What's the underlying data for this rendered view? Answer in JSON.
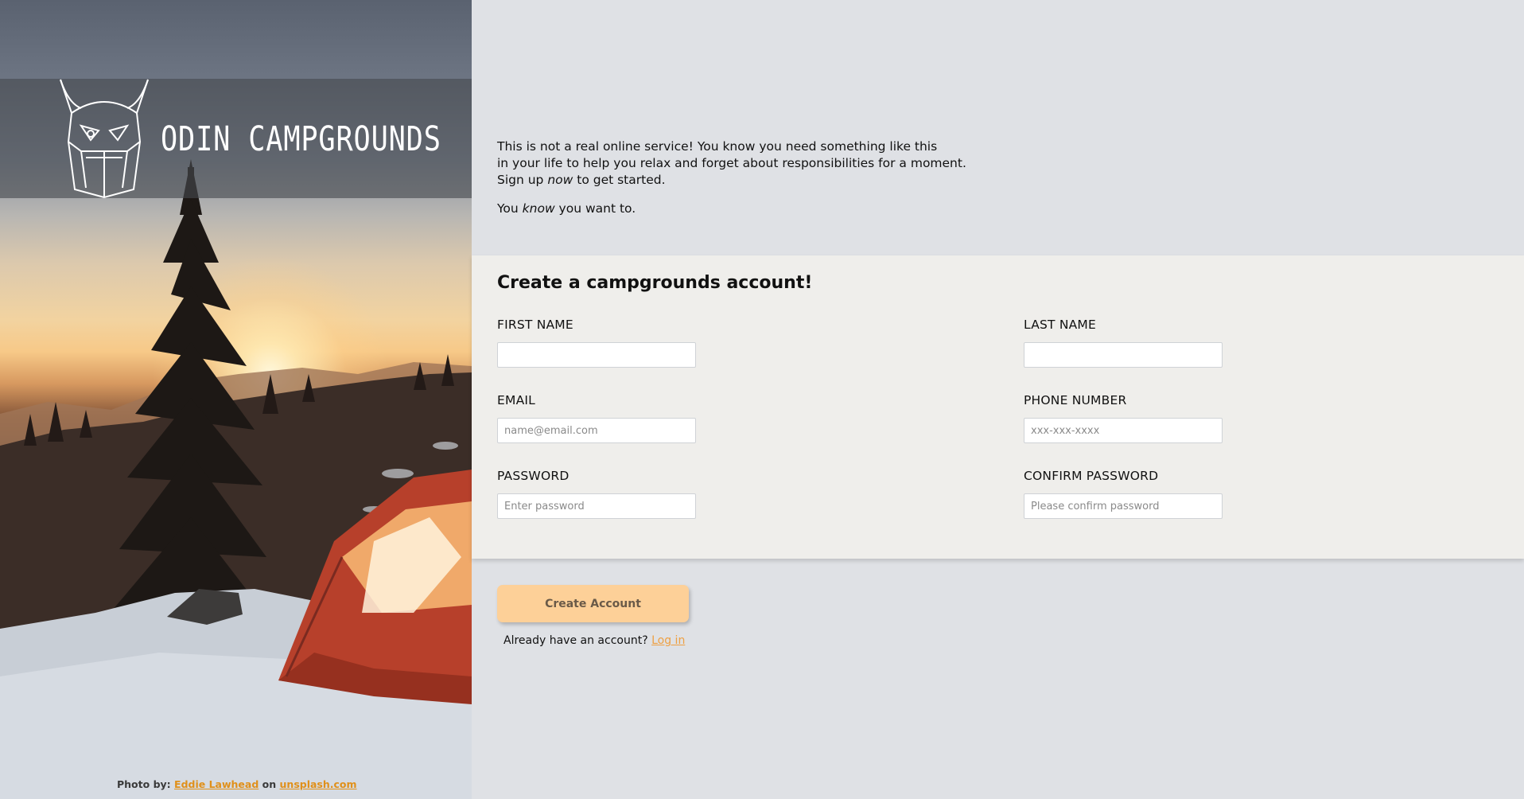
{
  "brand": {
    "title": "ODIN CAMPGROUNDS",
    "logo_icon": "viking-helmet-icon"
  },
  "credit": {
    "prefix": "Photo by:",
    "author": "Eddie Lawhead",
    "middle": "on",
    "site": "unsplash.com"
  },
  "intro": {
    "line1": "This is not a real online service! You know you need something like this",
    "line2": "in your life to help you relax and forget about responsibilities for a moment.",
    "line3_pre": "Sign up ",
    "line3_em": "now",
    "line3_post": " to get started.",
    "p2_pre": "You ",
    "p2_em": "know",
    "p2_post": " you want to."
  },
  "form": {
    "title": "Create a campgrounds account!",
    "fields": {
      "first_name": {
        "label": "FIRST NAME",
        "placeholder": ""
      },
      "last_name": {
        "label": "LAST NAME",
        "placeholder": ""
      },
      "email": {
        "label": "EMAIL",
        "placeholder": "name@email.com"
      },
      "phone": {
        "label": "PHONE NUMBER",
        "placeholder": "xxx-xxx-xxxx"
      },
      "password": {
        "label": "PASSWORD",
        "placeholder": "Enter password"
      },
      "confirm_password": {
        "label": "CONFIRM PASSWORD",
        "placeholder": "Please confirm password"
      }
    }
  },
  "actions": {
    "submit_label": "Create Account",
    "login_prompt": "Already have an account?",
    "login_link": "Log in"
  },
  "colors": {
    "accent": "#fdd098",
    "link": "#eea043",
    "form_bg": "#efeeeb",
    "page_bg": "#dfe1e5"
  }
}
